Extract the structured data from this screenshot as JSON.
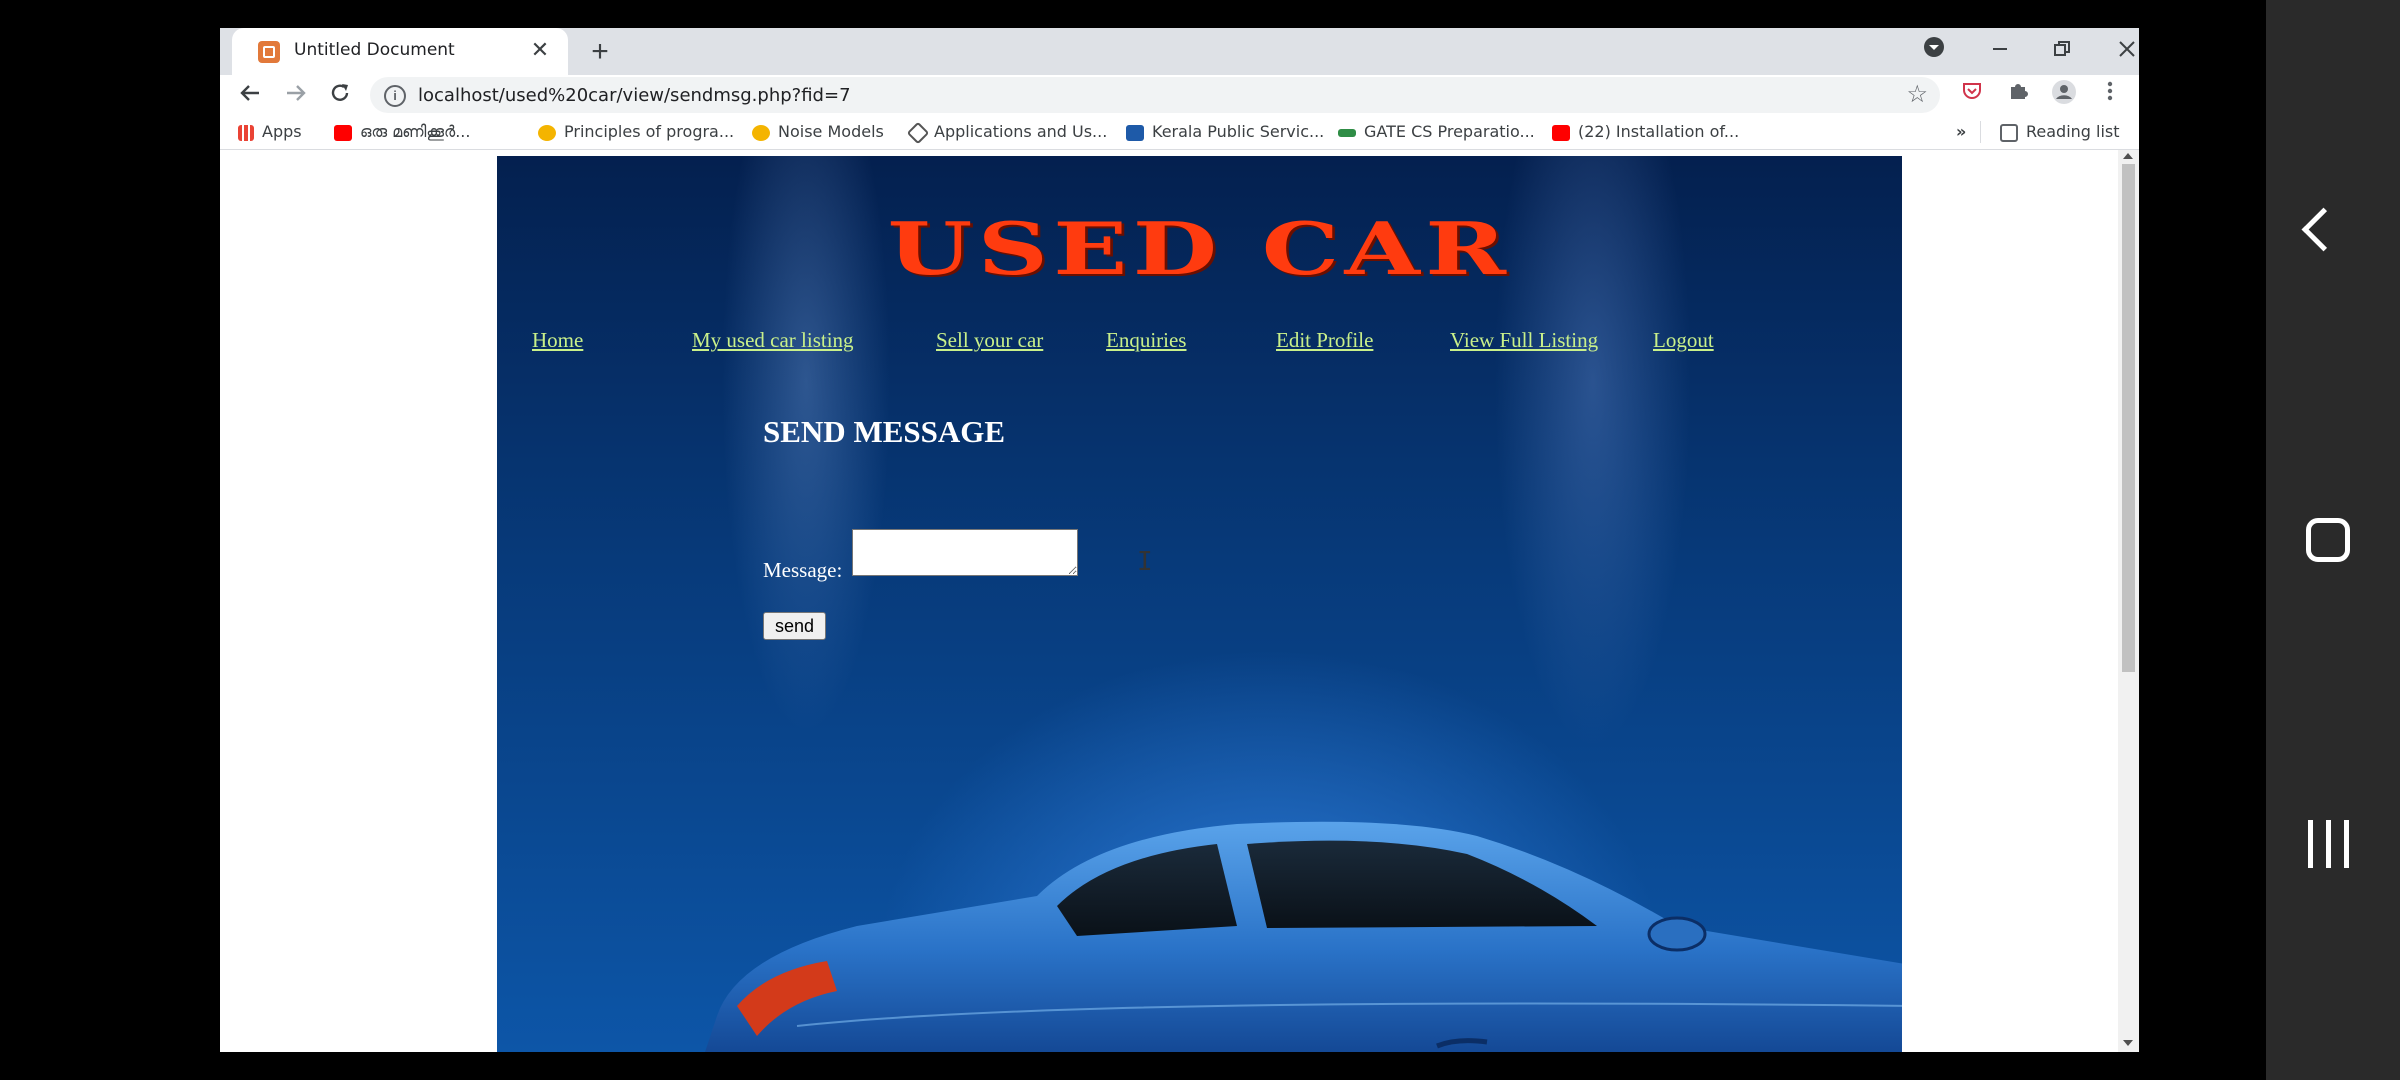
{
  "browser": {
    "tab_title": "Untitled Document",
    "tab_close": "✕",
    "new_tab": "+",
    "url": "localhost/used%20car/view/sendmsg.php?fid=7",
    "bookmarks": [
      {
        "label": "Apps",
        "icon": "apps-grid-icon",
        "color": "#4285f4"
      },
      {
        "label": "ഒരു മണിക്കൂർ...",
        "icon": "youtube-icon",
        "color": "#ff0000"
      },
      {
        "label": "Principles of progra...",
        "icon": "bookmark-site-icon",
        "color": "#4a90d9"
      },
      {
        "label": "Noise Models",
        "icon": "bookmark-site-icon",
        "color": "#4a90d9"
      },
      {
        "label": "Applications and Us...",
        "icon": "diamond-site-icon",
        "color": "#555555"
      },
      {
        "label": "Kerala Public Servic...",
        "icon": "psc-icon",
        "color": "#1e5aa8"
      },
      {
        "label": "GATE CS Preparatio...",
        "icon": "geeks-icon",
        "color": "#2f8d46"
      },
      {
        "label": "(22) Installation of...",
        "icon": "youtube-icon",
        "color": "#ff0000"
      }
    ],
    "more_bookmarks": "»",
    "reading_list": "Reading list"
  },
  "site": {
    "logo": "USED CAR",
    "nav": [
      "Home",
      "My used car listing",
      "Sell your car",
      "Enquiries",
      "Edit Profile",
      "View Full Listing",
      "Logout"
    ],
    "heading": "SEND MESSAGE",
    "message_label": "Message:",
    "message_value": "",
    "send_label": "send"
  },
  "colors": {
    "logo": "#ff3b0f",
    "nav_link": "#c9f08a",
    "site_bg": "#073a7a"
  }
}
